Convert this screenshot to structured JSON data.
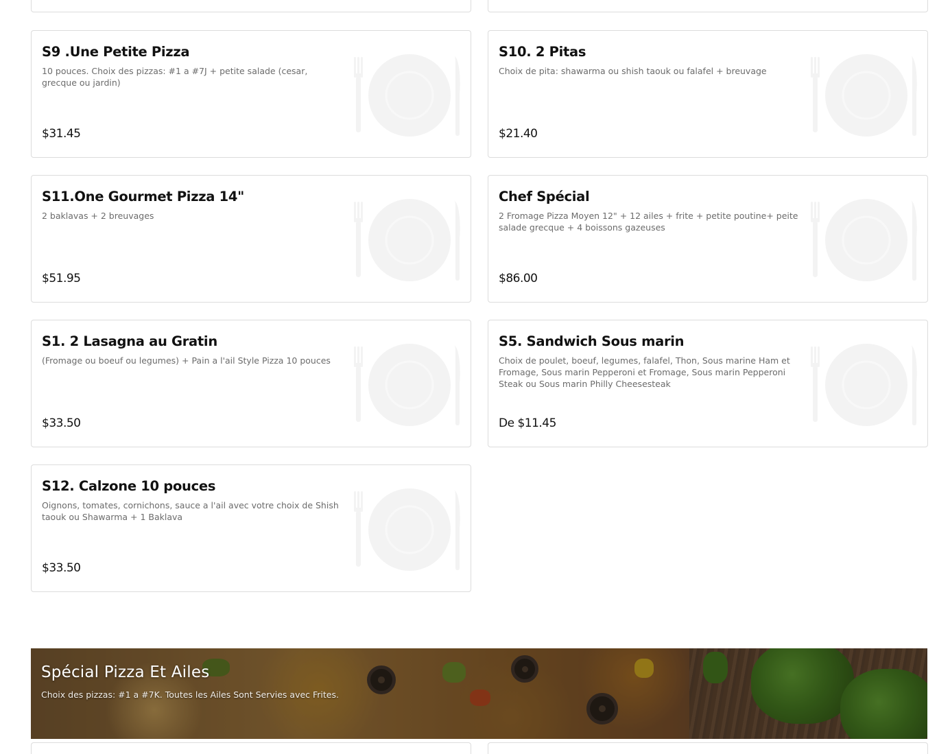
{
  "items": [
    {
      "title": "S9 .Une Petite Pizza",
      "description": "10 pouces. Choix des pizzas: #1 a #7J + petite salade (cesar, grecque ou jardin)",
      "price": "$31.45"
    },
    {
      "title": "S10. 2 Pitas",
      "description": "Choix de pita: shawarma ou shish taouk ou falafel + breuvage",
      "price": "$21.40"
    },
    {
      "title": "S11.One Gourmet Pizza 14\"",
      "description": "2 baklavas + 2 breuvages",
      "price": "$51.95"
    },
    {
      "title": "Chef Spécial",
      "description": "2 Fromage Pizza Moyen 12\" + 12 ailes + frite + petite poutine+ peite salade grecque + 4 boissons gazeuses",
      "price": "$86.00"
    },
    {
      "title": "S1. 2 Lasagna au Gratin",
      "description": "(Fromage ou boeuf ou legumes) + Pain a l'ail Style Pizza 10 pouces",
      "price": "$33.50"
    },
    {
      "title": "S5. Sandwich Sous marin",
      "description": "Choix de poulet, boeuf, legumes, falafel, Thon, Sous marine Ham et Fromage, Sous marin Pepperoni et Fromage, Sous marin Pepperoni Steak ou Sous marin Philly Cheesesteak",
      "price": "De $11.45"
    },
    {
      "title": "S12. Calzone 10 pouces",
      "description": "Oignons, tomates, cornichons, sauce a l'ail avec votre choix de Shish taouk ou Shawarma + 1 Baklava",
      "price": "$33.50"
    }
  ],
  "section": {
    "title": "Spécial Pizza Et Ailes",
    "description": "Choix des pizzas: #1 a #7K. Toutes les Ailes Sont Servies avec Frites."
  },
  "placeholder_icon": "plate-cutlery-icon",
  "colors": {
    "card_border": "#dcdcdc",
    "description": "#6b6b6b",
    "text": "#111111"
  }
}
